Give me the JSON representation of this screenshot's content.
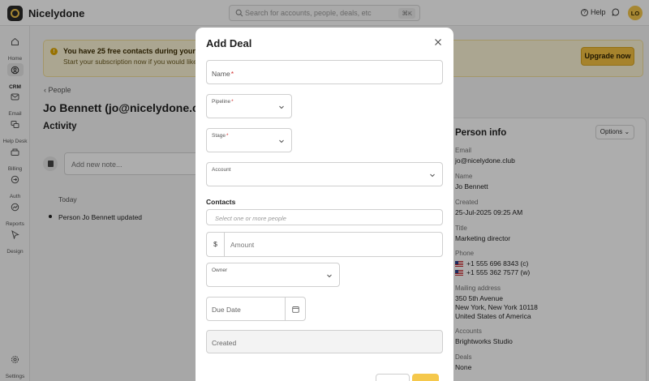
{
  "app": {
    "brand": "Nicelydone",
    "search_placeholder": "Search for accounts, people, deals, etc",
    "search_shortcut": "⌘K",
    "help_label": "Help",
    "avatar_initials": "LO"
  },
  "sidebar": {
    "items": [
      {
        "label": "Home",
        "icon": "home-icon"
      },
      {
        "label": "CRM",
        "icon": "crm-icon",
        "active": true
      },
      {
        "label": "Email",
        "icon": "email-icon"
      },
      {
        "label": "Help Desk",
        "icon": "help-desk-icon"
      },
      {
        "label": "Billing",
        "icon": "billing-icon"
      },
      {
        "label": "Auth",
        "icon": "auth-icon"
      },
      {
        "label": "Reports",
        "icon": "reports-icon"
      },
      {
        "label": "Design",
        "icon": "design-icon"
      }
    ],
    "settings_label": "Settings"
  },
  "banner": {
    "line1": "You have 25 free contacts during your free trial",
    "line2": "Start your subscription now if you would like to i",
    "upgrade_label": "Upgrade now"
  },
  "page": {
    "breadcrumb": "People",
    "title": "Jo Bennett (jo@nicelydone.club)",
    "activity_heading": "Activity",
    "note_placeholder": "Add new note...",
    "today_label": "Today",
    "timeline_item": "Person Jo Bennett updated"
  },
  "person_info": {
    "title": "Person info",
    "options_label": "Options",
    "email_label": "Email",
    "email": "jo@nicelydone.club",
    "name_label": "Name",
    "name": "Jo Bennett",
    "created_label": "Created",
    "created": "25-Jul-2025 09:25 AM",
    "title_label": "Title",
    "job_title": "Marketing director",
    "phone_label": "Phone",
    "phone1": "+1 555 696 8343 (c)",
    "phone2": "+1 555 362 7577 (w)",
    "address_label": "Mailing address",
    "address1": "350 5th Avenue",
    "address2": "New York, New York  10118",
    "address3": "United States of America",
    "accounts_label": "Accounts",
    "account": "Brightworks Studio",
    "deals_label": "Deals",
    "deals": "None"
  },
  "modal": {
    "title": "Add Deal",
    "name_label": "Name",
    "pipeline_label": "Pipeline",
    "stage_label": "Stage",
    "account_label": "Account",
    "contacts_heading": "Contacts",
    "contacts_placeholder": "Select one or more people",
    "currency_symbol": "$",
    "amount_placeholder": "Amount",
    "owner_label": "Owner",
    "due_date_placeholder": "Due Date",
    "created_placeholder": "Created"
  }
}
